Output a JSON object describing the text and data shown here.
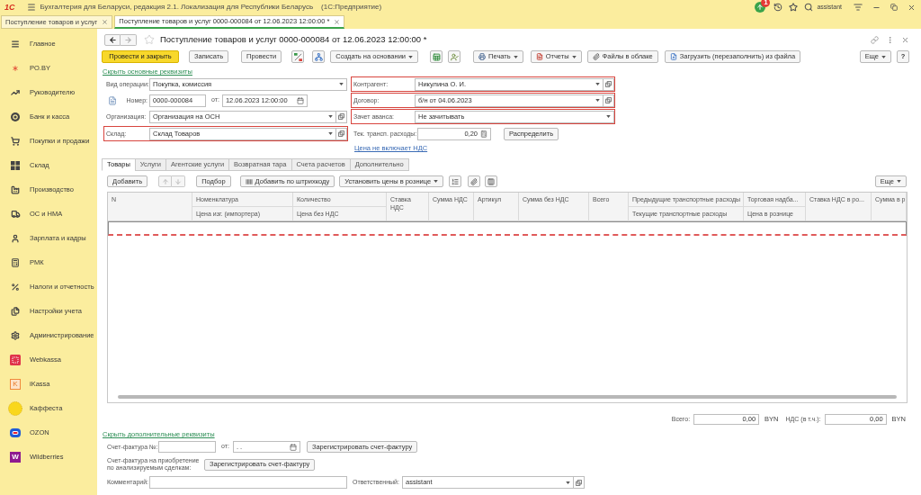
{
  "window": {
    "logo": "1С",
    "title": "Бухгалтерия для Беларуси, редакция 2.1. Локализация для Республики Беларусь",
    "platform": "(1С:Предприятие)",
    "notification_count": "1",
    "user": "assistant"
  },
  "open_tabs": [
    {
      "label": "Поступление товаров и услуг",
      "selected": false
    },
    {
      "label": "Поступление товаров и услуг 0000-000084 от 12.06.2023 12:00:00 *",
      "selected": true
    }
  ],
  "sidebar": {
    "items": [
      {
        "label": "Главное"
      },
      {
        "label": "PO.BY"
      },
      {
        "label": "Руководителю"
      },
      {
        "label": "Банк и касса"
      },
      {
        "label": "Покупки и продажи"
      },
      {
        "label": "Склад"
      },
      {
        "label": "Производство"
      },
      {
        "label": "ОС и НМА"
      },
      {
        "label": "Зарплата и кадры"
      },
      {
        "label": "РМК"
      },
      {
        "label": "Налоги и отчетность"
      },
      {
        "label": "Настройки учета"
      },
      {
        "label": "Администрирование"
      },
      {
        "label": "Webkassa"
      },
      {
        "label": "iKassa",
        "logo_letter": "K"
      },
      {
        "label": "Каффеста"
      },
      {
        "label": "OZON"
      },
      {
        "label": "Wildberries",
        "logo_letter": "W"
      }
    ]
  },
  "document": {
    "title": "Поступление товаров и услуг 0000-000084 от 12.06.2023 12:00:00 *",
    "favorite": false,
    "forward_disabled": true
  },
  "toolbar": {
    "post_and_close": "Провести и закрыть",
    "save": "Записать",
    "post": "Провести",
    "create_based_on": "Создать на основании",
    "print": "Печать",
    "reports": "Отчеты",
    "cloud_files": "Файлы в облаке",
    "load_from_file": "Загрузить (перезаполнить) из файла",
    "more": "Еще",
    "help": "?"
  },
  "hide_main_link": "Скрыть основные реквизиты",
  "fields": {
    "operation_type": {
      "label": "Вид операции:",
      "value": "Покупка, комиссия"
    },
    "number": {
      "label": "Номер:",
      "value": "0000-000084"
    },
    "date": {
      "label": "от:",
      "value": "12.06.2023 12:00:00"
    },
    "organization": {
      "label": "Организация:",
      "value": "Организация на ОСН",
      "highlighted": false
    },
    "warehouse": {
      "label": "Склад:",
      "value": "Склад Товаров",
      "highlighted": true
    },
    "counterparty": {
      "label": "Контрагент:",
      "value": "Никулина О. И.",
      "highlighted": true
    },
    "contract": {
      "label": "Договор:",
      "value": "б/н от 04.06.2023",
      "highlighted": true
    },
    "advance_offset": {
      "label": "Зачет аванса:",
      "value": "Не зачитывать",
      "highlighted": true
    },
    "transport_costs": {
      "label": "Тек. трансп. расходы:",
      "value": "0,20"
    },
    "distribute_button": "Распределить",
    "vat_link": "Цена не включает НДС"
  },
  "tabs": [
    {
      "label": "Товары",
      "selected": true
    },
    {
      "label": "Услуги",
      "selected": false
    },
    {
      "label": "Агентские услуги",
      "selected": false
    },
    {
      "label": "Возвратная тара",
      "selected": false
    },
    {
      "label": "Счета расчетов",
      "selected": false
    },
    {
      "label": "Дополнительно",
      "selected": false
    }
  ],
  "table_toolbar": {
    "add": "Добавить",
    "reorder_disabled": true,
    "pick": "Подбор",
    "add_by_barcode": "Добавить по штрихкоду",
    "set_retail_prices": "Установить цены в рознице",
    "more": "Еще"
  },
  "table": {
    "columns": [
      {
        "label": "N"
      },
      {
        "label": "Номенклатура",
        "sublabel": "Цена изг. (импортера)"
      },
      {
        "label": "Количество",
        "sublabel": "Цена без НДС"
      },
      {
        "label": "Ставка НДС"
      },
      {
        "label": "Сумма НДС"
      },
      {
        "label": "Артикул"
      },
      {
        "label": "Сумма без НДС"
      },
      {
        "label": "Всего"
      },
      {
        "label": "Предыдущие транспортные расходы",
        "sublabel": "Текущие транспортные расходы"
      },
      {
        "label": "Торговая надба...",
        "sublabel": "Цена в рознице"
      },
      {
        "label": "Ставка НДС в ро..."
      },
      {
        "label": "Сумма в р"
      }
    ],
    "input_row_invalid": true
  },
  "totals": [
    {
      "label": "Всего:",
      "value": "0,00",
      "currency": "BYN"
    },
    {
      "label": "НДС (в т.ч.):",
      "value": "0,00",
      "currency": "BYN"
    }
  ],
  "hide_extra_link": "Скрыть дополнительные реквизиты",
  "invoice": {
    "label": "Счет-фактура №:",
    "date_label": "от:",
    "date_value": ". .",
    "button": "Зарегистрировать счет-фактуру"
  },
  "analyzed_invoice": {
    "label": "Счет-фактура на приобретение по анализируемым сделкам:",
    "button": "Зарегистрировать счет-фактуру"
  },
  "comment": {
    "label": "Комментарий:"
  },
  "responsible": {
    "label": "Ответственный:",
    "value": "assistant"
  }
}
